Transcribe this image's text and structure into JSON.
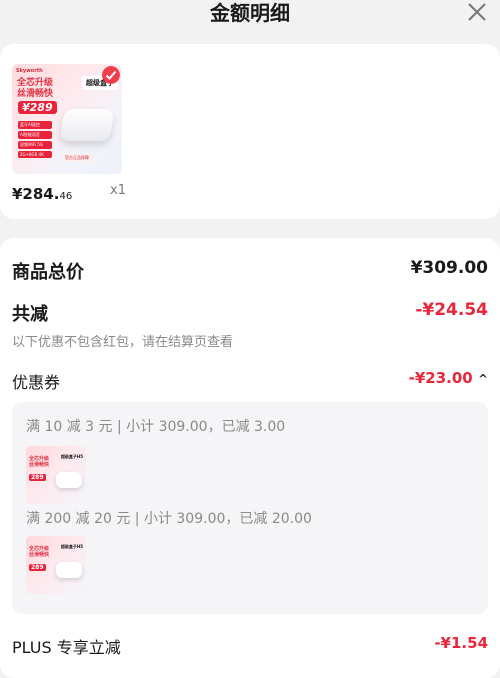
{
  "header": {
    "title": "金额明细"
  },
  "product": {
    "image": {
      "brand": "Skyworth",
      "slogan_line1": "全芯升级",
      "slogan_line2": "丝滑畅快",
      "price_tag": "¥289",
      "chip1": "蓝牙AI遥控",
      "chip2": "AI智能语音",
      "chip3": "双频WiFi 5G",
      "chip4": "2G+8GB 4K",
      "badge": "超级盒子",
      "footline": "官方正品保障"
    },
    "price_main": "¥284.",
    "price_decimal": "46",
    "quantity": "x1"
  },
  "summary": {
    "total_label": "商品总价",
    "total_value": "¥309.00",
    "discount_label": "共减",
    "discount_value": "-¥24.54",
    "discount_note": "以下优惠不包含红包，请在结算页查看",
    "coupon_label": "优惠券",
    "coupon_value": "-¥23.00",
    "coupon_toggle": "^"
  },
  "coupons": [
    {
      "text": "满 10 减 3 元 | 小计 309.00，已减 3.00"
    },
    {
      "text": "满 200 减 20 元 | 小计 309.00，已减 20.00"
    }
  ],
  "mini_image": {
    "slogan_line1": "全芯升级",
    "slogan_line2": "丝滑畅快",
    "price_tag": "289",
    "badge": "超级盒子H5"
  },
  "plus": {
    "label": "PLUS 专享立减",
    "value": "-¥1.54"
  },
  "colors": {
    "accent_red": "#e8283a",
    "background": "#f2f2f2"
  }
}
